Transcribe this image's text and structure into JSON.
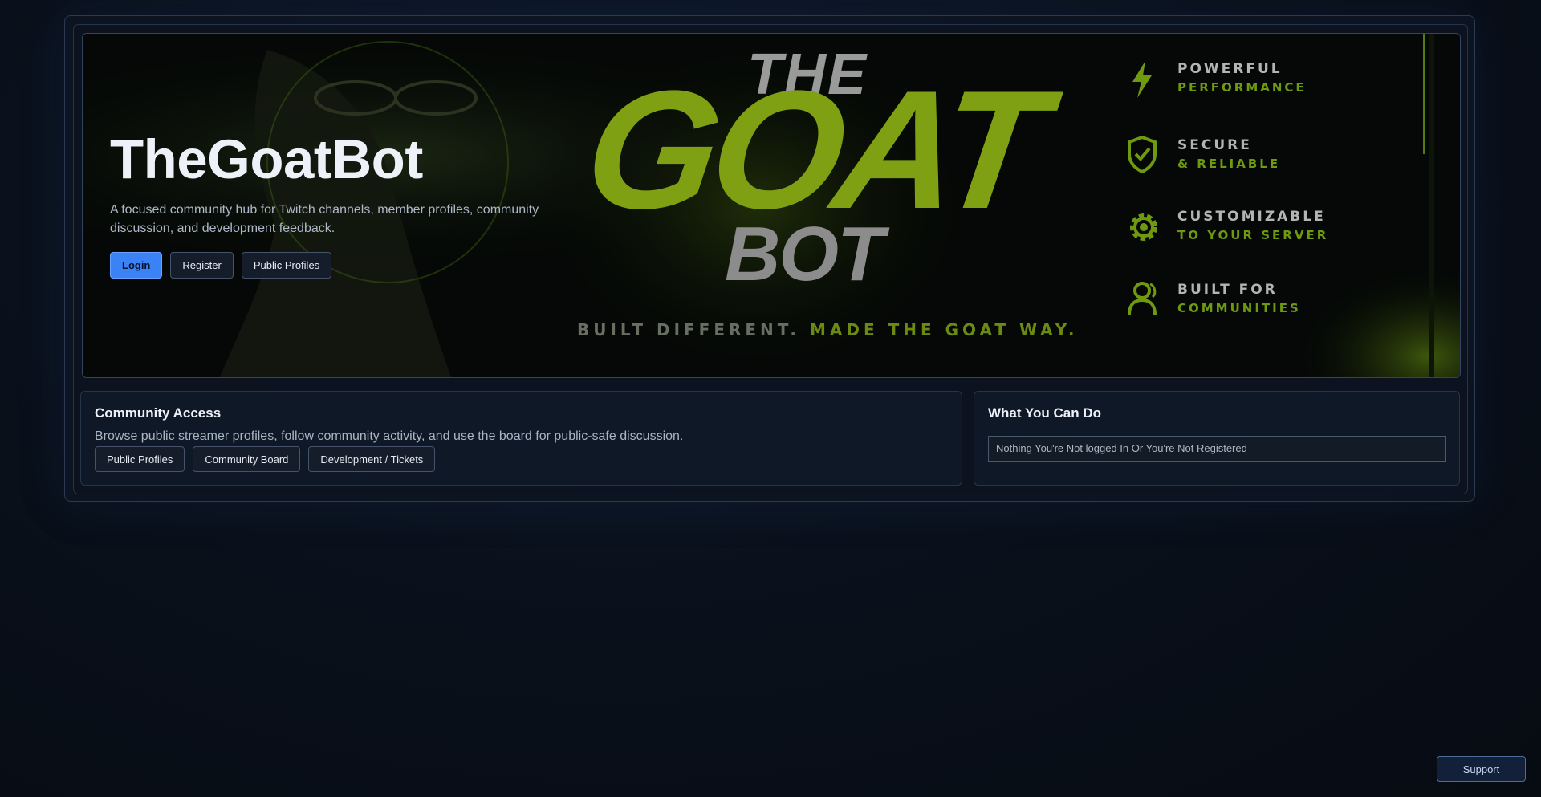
{
  "hero": {
    "title": "TheGoatBot",
    "description": "A focused community hub for Twitch channels, member profiles, community discussion, and development feedback.",
    "buttons": {
      "login": "Login",
      "register": "Register",
      "public_profiles": "Public Profiles"
    },
    "banner": {
      "word_the": "THE",
      "word_goat": "GOAT",
      "word_bot": "BOT",
      "tagline_part1": "BUILT DIFFERENT.",
      "tagline_part2": "MADE THE GOAT WAY.",
      "features": [
        {
          "icon": "lightning-icon",
          "line1": "POWERFUL",
          "line2": "PERFORMANCE"
        },
        {
          "icon": "shield-check-icon",
          "line1": "SECURE",
          "line2": "& RELIABLE"
        },
        {
          "icon": "gear-icon",
          "line1": "CUSTOMIZABLE",
          "line2": "TO YOUR SERVER"
        },
        {
          "icon": "users-icon",
          "line1": "BUILT FOR",
          "line2": "COMMUNITIES"
        }
      ]
    }
  },
  "community_access": {
    "title": "Community Access",
    "description": "Browse public streamer profiles, follow community activity, and use the board for public-safe discussion.",
    "buttons": {
      "public_profiles": "Public Profiles",
      "community_board": "Community Board",
      "development": "Development / Tickets"
    }
  },
  "what_you_can_do": {
    "title": "What You Can Do",
    "status": "Nothing You're Not logged In Or You're Not Registered"
  },
  "support_label": "Support",
  "colors": {
    "accent": "#3b82f6",
    "banner_green": "#7fa012",
    "banner_grey": "#8c8c8c",
    "background": "#0a111c"
  }
}
